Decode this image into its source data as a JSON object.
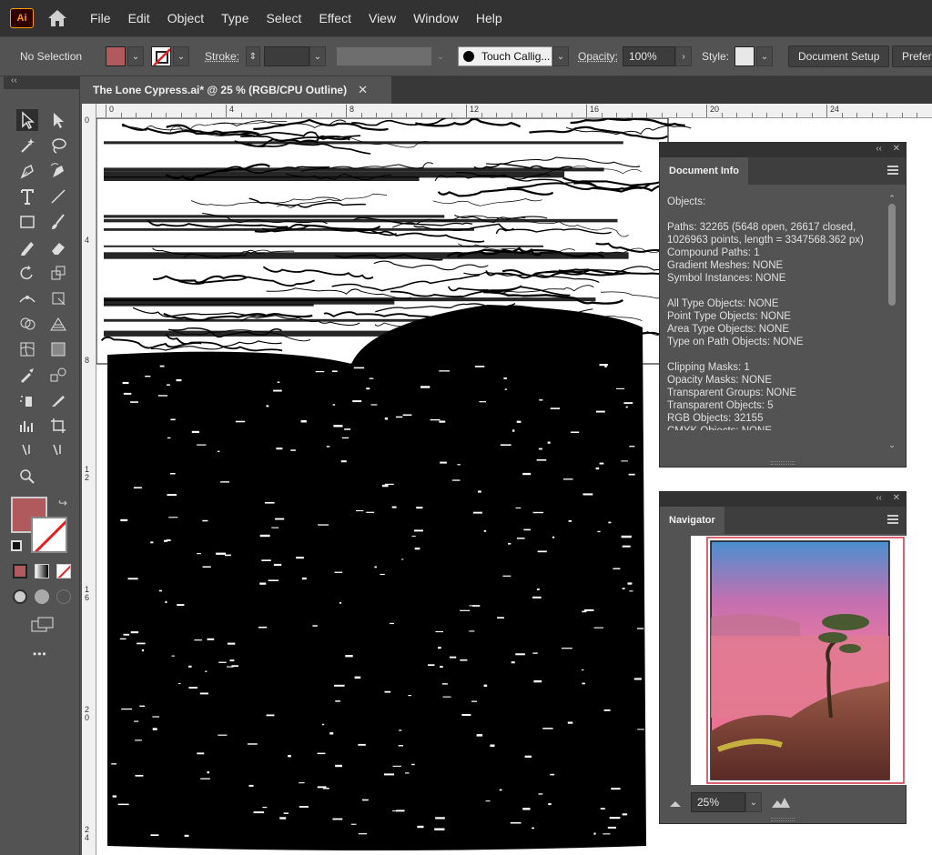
{
  "app": {
    "logo": "Ai"
  },
  "menu": [
    "File",
    "Edit",
    "Object",
    "Type",
    "Select",
    "Effect",
    "View",
    "Window",
    "Help"
  ],
  "control": {
    "selection": "No Selection",
    "fill_color": "#b05a5e",
    "stroke_label": "Stroke:",
    "brush": "Touch Callig...",
    "opacity_label": "Opacity:",
    "opacity_value": "100%",
    "style_label": "Style:",
    "doc_setup": "Document Setup",
    "prefs": "Prefere"
  },
  "document": {
    "tab_title": "The Lone Cypress.ai* @ 25 % (RGB/CPU Outline)",
    "close": "✕"
  },
  "ruler": {
    "h": [
      "0",
      "4",
      "8",
      "12",
      "16",
      "20",
      "24"
    ],
    "v": [
      "0",
      "4",
      "8",
      "1 2",
      "1 6",
      "2 0",
      "2 4"
    ]
  },
  "doc_info": {
    "title": "Document Info",
    "lines": [
      "Objects:",
      "",
      "Paths: 32265 (5648 open, 26617 closed,",
      "1026963 points, length = 3347568.362 px)",
      "Compound Paths: 1",
      "Gradient Meshes: NONE",
      "Symbol Instances: NONE",
      "",
      "All Type Objects: NONE",
      "Point Type Objects: NONE",
      "Area Type Objects: NONE",
      "Type on Path Objects: NONE",
      "",
      "Clipping Masks: 1",
      "Opacity Masks: NONE",
      "Transparent Groups: NONE",
      "Transparent Objects: 5",
      "RGB Objects: 32155",
      "CMYK Objects: NONE"
    ]
  },
  "navigator": {
    "title": "Navigator",
    "zoom": "25%"
  },
  "icons": {
    "collapse": "‹‹",
    "close": "✕",
    "dropdown": "⌄",
    "more": "•••"
  }
}
